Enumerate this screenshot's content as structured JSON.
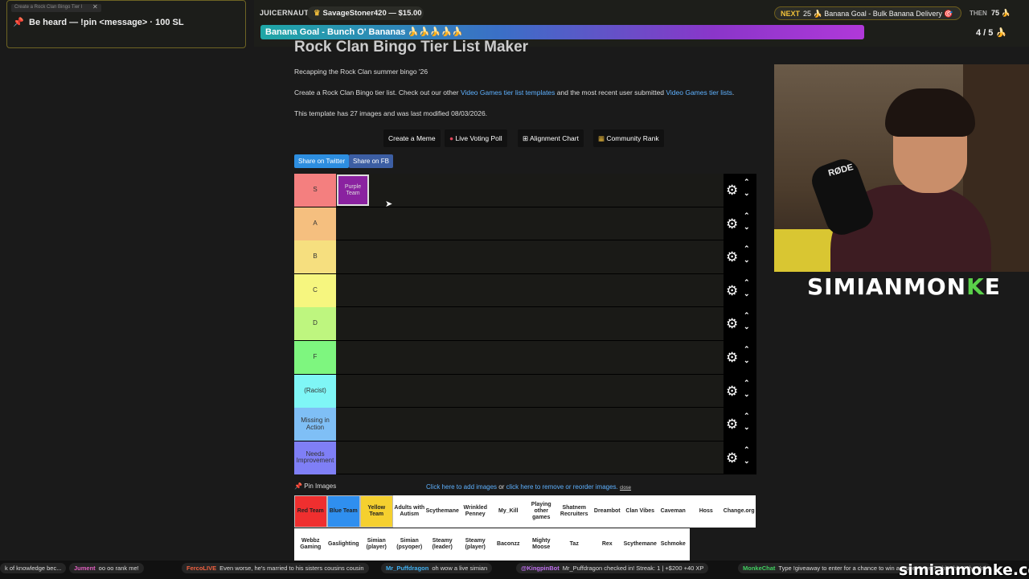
{
  "overlay": {
    "browser_tab": "Create a Rock Clan Bingo Tier l",
    "tab_close": "✕",
    "pin_message": "Be heard — !pin <message> · 100 SL",
    "donor_label": "JUICERNAUT",
    "donor_text": "SavageStoner420 — $15.00",
    "goal_text": "Banana Goal - Bunch O' Bananas 🍌🍌🍌🍌🍌",
    "goal_count": "4 / 5 🍌",
    "next_label": "NEXT",
    "next_text": "25 🍌 Banana Goal - Bulk Banana Delivery 🎯",
    "then_label": "THEN",
    "then_value": "75 🍌"
  },
  "page": {
    "title": "Rock Clan Bingo Tier List Maker",
    "subtitle": "Recapping the Rock Clan summer bingo '26",
    "desc_prefix": "Create a Rock Clan Bingo tier list. Check out our other ",
    "desc_link1": "Video Games tier list templates",
    "desc_mid": " and the most recent user submitted ",
    "desc_link2": "Video Games tier lists",
    "desc_suffix": ".",
    "template_info": "This template has 27 images and was last modified 08/03/2026.",
    "buttons": {
      "create_meme": "Create a Meme",
      "live_poll": "Live Voting Poll",
      "alignment": "Alignment Chart",
      "community": "Community Rank"
    },
    "share_twitter": "Share on Twitter",
    "share_fb": "Share on FB"
  },
  "tiers": [
    {
      "label": "S",
      "color": "#f47f7f"
    },
    {
      "label": "A",
      "color": "#f5bf7f"
    },
    {
      "label": "B",
      "color": "#f6df7f"
    },
    {
      "label": "C",
      "color": "#f6f67f"
    },
    {
      "label": "D",
      "color": "#bef67f"
    },
    {
      "label": "F",
      "color": "#7ef67f"
    },
    {
      "label": "(Racist)",
      "color": "#7ff6f6"
    },
    {
      "label": "Missing in Action",
      "color": "#7fbff6"
    },
    {
      "label": "Needs Improvement",
      "color": "#7f7ff6"
    }
  ],
  "placed_tile": "Purple Team",
  "icons": {
    "gear": "⚙",
    "up": "⌃",
    "down": "⌄",
    "pin": "📌"
  },
  "pin_images": "Pin Images",
  "add_links": {
    "add": "Click here to add images",
    "or": " or ",
    "reorder": "click here to remove or reorder images.",
    "close": "close"
  },
  "image_pool": {
    "row1": [
      {
        "label": "Red Team",
        "color": "#ef2f2f"
      },
      {
        "label": "Blue Team",
        "color": "#2f8fef"
      },
      {
        "label": "Yellow Team",
        "color": "#f5d02f"
      },
      {
        "label": "Adults with Autism",
        "color": "#ffffff"
      },
      {
        "label": "Scythemane",
        "color": "#ffffff"
      },
      {
        "label": "Wrinkled Penney",
        "color": "#ffffff"
      },
      {
        "label": "My_Kill",
        "color": "#ffffff"
      },
      {
        "label": "Playing other games",
        "color": "#ffffff"
      },
      {
        "label": "Shatnem Recruiters",
        "color": "#ffffff"
      },
      {
        "label": "Dreambot",
        "color": "#ffffff"
      },
      {
        "label": "Clan Vibes",
        "color": "#ffffff"
      },
      {
        "label": "Caveman",
        "color": "#ffffff"
      },
      {
        "label": "Hoss",
        "color": "#ffffff"
      },
      {
        "label": "Change.org",
        "color": "#ffffff"
      }
    ],
    "row2": [
      {
        "label": "Webbz Gaming"
      },
      {
        "label": "Gaslighting"
      },
      {
        "label": "Simian (player)"
      },
      {
        "label": "Simian (psyoper)"
      },
      {
        "label": "Steamy (leader)"
      },
      {
        "label": "Steamy (player)"
      },
      {
        "label": "Baconzz"
      },
      {
        "label": "Mighty Moose"
      },
      {
        "label": "Taz"
      },
      {
        "label": "Rex"
      },
      {
        "label": "Scythemane"
      },
      {
        "label": "Schmoke"
      }
    ]
  },
  "webcam": {
    "mic_brand": "RØDE"
  },
  "logo": {
    "pre": "SIMIANMON",
    "k": "K",
    "post": "E"
  },
  "chat": [
    {
      "name": "",
      "text": "k of knowledge bec...",
      "color": "#ddd"
    },
    {
      "name": "Jument",
      "text": "oo oo rank me!",
      "color": "#e060c0"
    },
    {
      "name": "FercoLIVE",
      "text": "Even worse, he's married to his sisters cousins cousin",
      "color": "#f06040"
    },
    {
      "name": "Mr_Puffdragon",
      "text": "oh wow a live simian",
      "color": "#40b0f0"
    },
    {
      "name": "@KingpinBot",
      "text": "Mr_Puffdragon checked in! Streak: 1 | +$200 +40 XP",
      "color": "#c070f0"
    },
    {
      "name": "MonkeChat",
      "text": "Type !giveaway to enter for a chance to win a Runescape T-shirt this July! Unl",
      "color": "#40d060"
    }
  ],
  "watermark": "simianmonke.com"
}
